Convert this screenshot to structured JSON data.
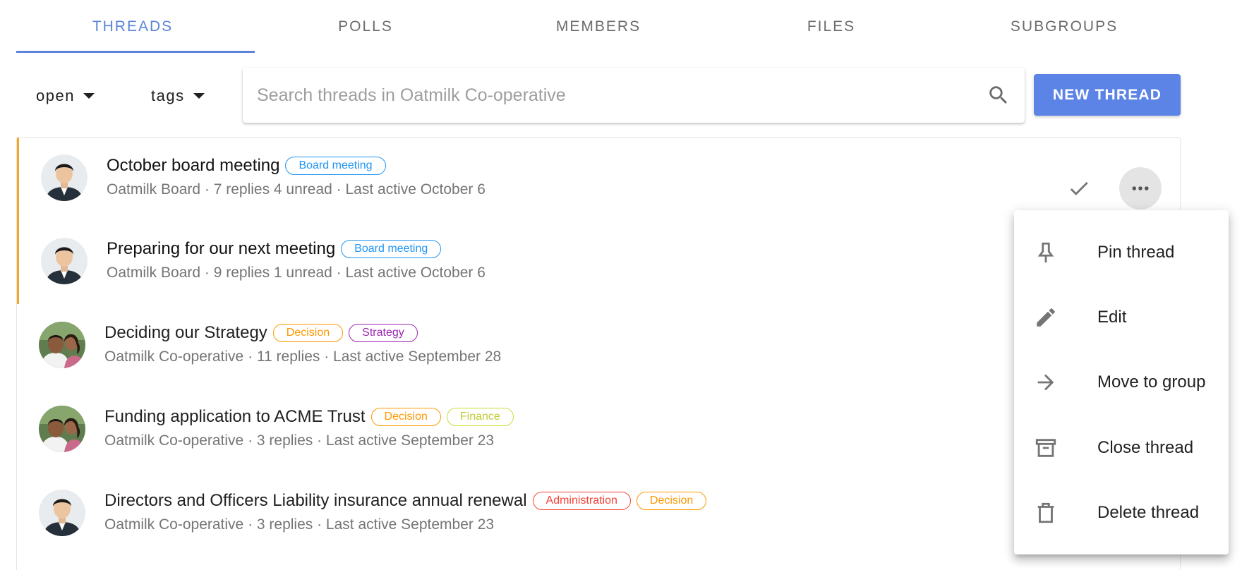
{
  "tabs": [
    {
      "label": "THREADS",
      "active": true
    },
    {
      "label": "POLLS"
    },
    {
      "label": "MEMBERS"
    },
    {
      "label": "FILES"
    },
    {
      "label": "SUBGROUPS"
    }
  ],
  "toolbar": {
    "open_filter": "open",
    "tags_filter": "tags",
    "search_placeholder": "Search threads in Oatmilk Co-operative",
    "new_thread_label": "NEW THREAD"
  },
  "colors": {
    "accent": "#5b84e6",
    "unread_bar": "#f5a623",
    "tag_board": "#2196f3",
    "tag_decision": "#ff9800",
    "tag_strategy": "#9c27b0",
    "tag_finance": "#cddc39",
    "tag_administration": "#f44336"
  },
  "threads": [
    {
      "title": "October board meeting",
      "tags": [
        {
          "label": "Board meeting",
          "color": "#2196f3"
        }
      ],
      "meta": "Oatmilk Board · 7 replies 4 unread · Last active October 6",
      "avatar": "person-avatar",
      "unread": true
    },
    {
      "title": "Preparing for our next meeting",
      "tags": [
        {
          "label": "Board meeting",
          "color": "#2196f3"
        }
      ],
      "meta": "Oatmilk Board · 9 replies 1 unread · Last active October 6",
      "avatar": "person-avatar",
      "unread": true
    },
    {
      "title": "Deciding our Strategy",
      "tags": [
        {
          "label": "Decision",
          "color": "#ff9800"
        },
        {
          "label": "Strategy",
          "color": "#9c27b0"
        }
      ],
      "meta": "Oatmilk Co-operative · 11 replies  · Last active September 28",
      "avatar": "family-avatar",
      "unread": false
    },
    {
      "title": "Funding application to ACME Trust",
      "tags": [
        {
          "label": "Decision",
          "color": "#ff9800"
        },
        {
          "label": "Finance",
          "color": "#cddc39"
        }
      ],
      "meta": "Oatmilk Co-operative · 3 replies  · Last active September 23",
      "avatar": "family-avatar",
      "unread": false
    },
    {
      "title": "Directors and Officers Liability insurance annual renewal",
      "tags": [
        {
          "label": "Administration",
          "color": "#f44336"
        },
        {
          "label": "Decision",
          "color": "#ff9800"
        }
      ],
      "meta": "Oatmilk Co-operative · 3 replies  · Last active September 23",
      "avatar": "person-avatar",
      "unread": false
    }
  ],
  "menu": [
    {
      "label": "Pin thread",
      "icon": "pin-icon"
    },
    {
      "label": "Edit",
      "icon": "pencil-icon"
    },
    {
      "label": "Move to group",
      "icon": "arrow-right-icon"
    },
    {
      "label": "Close thread",
      "icon": "archive-icon"
    },
    {
      "label": "Delete thread",
      "icon": "trash-icon"
    }
  ]
}
